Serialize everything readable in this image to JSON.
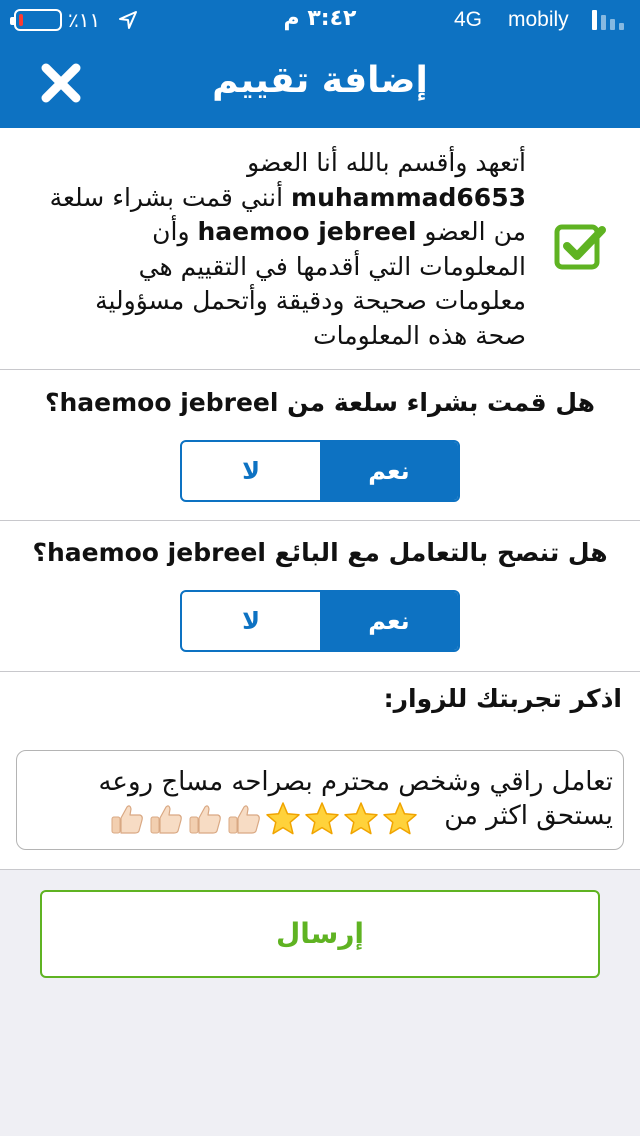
{
  "status_bar": {
    "battery_percent": "٪١١",
    "battery_level": 0.11,
    "time": "٣:٤٢ م",
    "network": "4G",
    "carrier": "mobily"
  },
  "header": {
    "title": "إضافة تقييم"
  },
  "pledge": {
    "line1": "أتعهد وأقسم بالله أنا العضو",
    "buyer": "muhammad6653",
    "line2_suffix": " أنني قمت بشراء سلعة",
    "line3_prefix": "من العضو ",
    "seller": "haemoo jebreel",
    "line3_suffix": " وأن",
    "line4": "المعلومات التي أقدمها في التقييم هي",
    "line5": "معلومات صحيحة ودقيقة وأتحمل مسؤولية",
    "line6": "صحة هذه المعلومات",
    "checked": true
  },
  "q1": {
    "prefix": "هل قمت بشراء سلعة من ",
    "seller": "haemoo jebreel",
    "suffix": "؟",
    "yes_label": "نعم",
    "no_label": "لا",
    "selected": "yes"
  },
  "q2": {
    "prefix": "هل تنصح بالتعامل مع البائع ",
    "seller": "haemoo jebreel",
    "suffix": "؟",
    "yes_label": "نعم",
    "no_label": "لا",
    "selected": "yes"
  },
  "experience": {
    "label": "اذكر تجربتك للزوار:",
    "text_line1": "تعامل راقي وشخص محترم بصراحه مساج روعه",
    "text_line2": "يستحق اكثر من",
    "stars": 4,
    "thumbs": 4
  },
  "submit": {
    "label": "إرسال"
  },
  "colors": {
    "primary": "#0d72c2",
    "accent_green": "#5fb322",
    "background": "#efeff4"
  }
}
